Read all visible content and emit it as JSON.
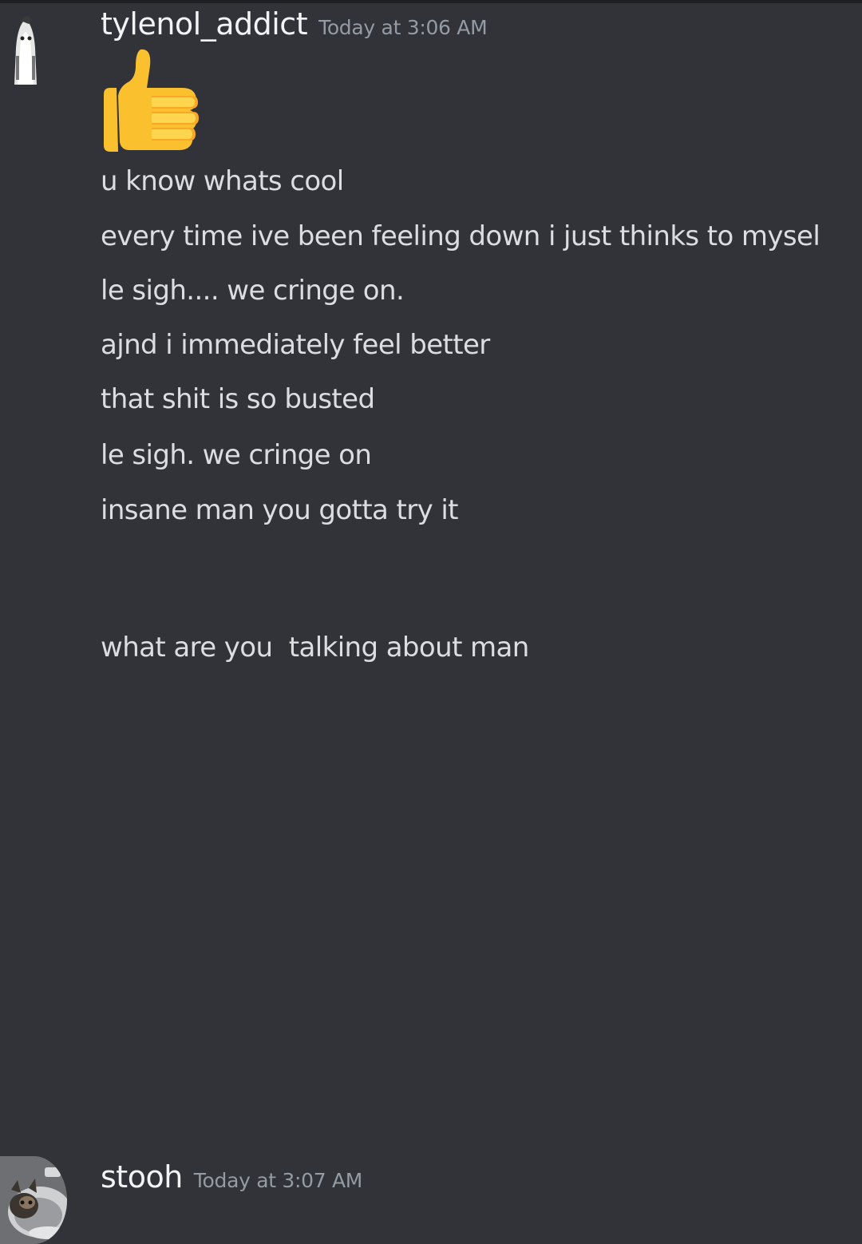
{
  "messages": [
    {
      "username": "tylenol_addict",
      "timestamp": "Today at 3:06 AM",
      "emoji": "thumbs-up",
      "lines": [
        "u know whats cool",
        "every time ive been feeling down i just thinks to mysel",
        "le sigh.... we cringe on.",
        "ajnd i immediately feel better",
        "that shit is so busted",
        "le sigh. we cringe on",
        "insane man you gotta try it"
      ]
    },
    {
      "username": "stooh",
      "timestamp": "Today at 3:07 AM",
      "lines": [
        "what are you  talking about man"
      ]
    }
  ],
  "colors": {
    "background": "#313338",
    "text": "#dbdee1",
    "username": "#f2f3f5",
    "timestamp": "#949ba4",
    "thumb": "#fbc02d"
  }
}
